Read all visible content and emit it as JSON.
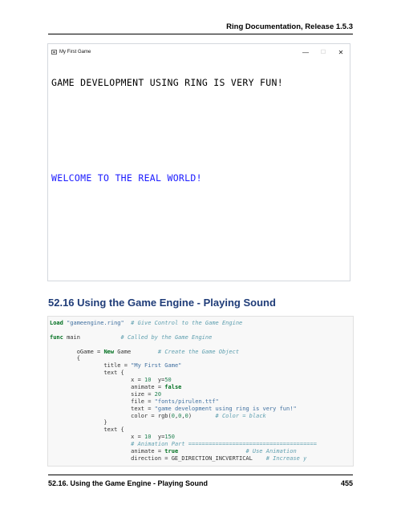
{
  "header": {
    "running_title": "Ring Documentation, Release 1.5.3"
  },
  "window": {
    "title": "My First Game",
    "controls": {
      "minimize": "—",
      "maximize": "☐",
      "close": "✕"
    }
  },
  "game": {
    "text1": "game development using ring is very fun!",
    "text1_color": "#000000",
    "text2": "Welcome to the Real World!",
    "text2_color": "#1a1aff"
  },
  "section": {
    "title": "52.16 Using the Game Engine - Playing Sound"
  },
  "code": [
    [
      [
        "kw",
        "Load"
      ],
      [
        "id",
        " "
      ],
      [
        "str",
        "\"gameengine.ring\""
      ],
      [
        "id",
        "  "
      ],
      [
        "cmt",
        "# Give Control to the Game Engine"
      ]
    ],
    [],
    [
      [
        "kw",
        "func"
      ],
      [
        "id",
        " main            "
      ],
      [
        "cmt",
        "# Called by the Game Engine"
      ]
    ],
    [],
    [
      [
        "id",
        "        oGame = "
      ],
      [
        "kw",
        "New"
      ],
      [
        "id",
        " Game        "
      ],
      [
        "cmt",
        "# Create the Game Object"
      ]
    ],
    [
      [
        "id",
        "        {"
      ]
    ],
    [
      [
        "id",
        "                title = "
      ],
      [
        "str",
        "\"My First Game\""
      ]
    ],
    [
      [
        "id",
        "                text {"
      ]
    ],
    [
      [
        "id",
        "                        x = "
      ],
      [
        "num",
        "10"
      ],
      [
        "id",
        "  y="
      ],
      [
        "num",
        "50"
      ]
    ],
    [
      [
        "id",
        "                        animate = "
      ],
      [
        "kw",
        "false"
      ]
    ],
    [
      [
        "id",
        "                        size = "
      ],
      [
        "num",
        "20"
      ]
    ],
    [
      [
        "id",
        "                        file = "
      ],
      [
        "str",
        "\"fonts/pirulen.ttf\""
      ]
    ],
    [
      [
        "id",
        "                        text = "
      ],
      [
        "str",
        "\"game development using ring is very fun!\""
      ]
    ],
    [
      [
        "id",
        "                        color = rgb("
      ],
      [
        "num",
        "0"
      ],
      [
        "id",
        ","
      ],
      [
        "num",
        "0"
      ],
      [
        "id",
        ","
      ],
      [
        "num",
        "0"
      ],
      [
        "id",
        ")       "
      ],
      [
        "cmt",
        "# Color = black"
      ]
    ],
    [
      [
        "id",
        "                }"
      ]
    ],
    [
      [
        "id",
        "                text {"
      ]
    ],
    [
      [
        "id",
        "                        x = "
      ],
      [
        "num",
        "10"
      ],
      [
        "id",
        "  y="
      ],
      [
        "num",
        "150"
      ]
    ],
    [
      [
        "id",
        "                        "
      ],
      [
        "cmt",
        "# Animation Part ======================================"
      ]
    ],
    [
      [
        "id",
        "                        animate = "
      ],
      [
        "kw",
        "true"
      ],
      [
        "id",
        "                    "
      ],
      [
        "cmt",
        "# Use Animation"
      ]
    ],
    [
      [
        "id",
        "                        direction = GE_DIRECTION_INCVERTICAL    "
      ],
      [
        "cmt",
        "# Increase y"
      ]
    ]
  ],
  "footer": {
    "section": "52.16.  Using the Game Engine - Playing Sound",
    "page": "455"
  }
}
